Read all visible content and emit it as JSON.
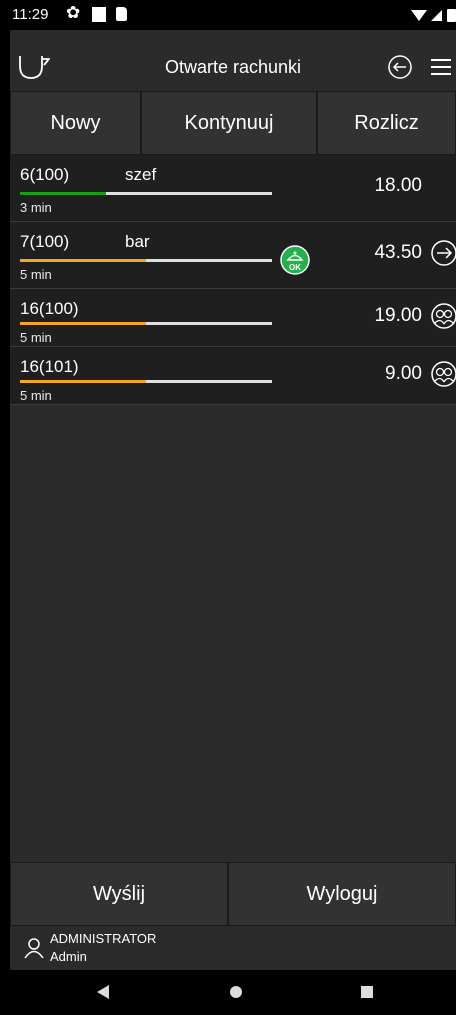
{
  "status_bar": {
    "time": "11:29"
  },
  "header": {
    "title": "Otwarte rachunki"
  },
  "actions": {
    "new": "Nowy",
    "continue": "Kontynuuj",
    "settle": "Rozlicz"
  },
  "orders": [
    {
      "number": "6(100)",
      "name": "szef",
      "time": "3 min",
      "amount": "18.00",
      "progress": 0.34,
      "progress_color": "#1a9f1a",
      "icon": ""
    },
    {
      "number": "7(100)",
      "name": "bar",
      "time": "5 min",
      "amount": "43.50",
      "progress": 0.5,
      "progress_color": "#f5a623",
      "icon": "arrow-right-icon",
      "ok_badge": "OK"
    },
    {
      "number": "16(100)",
      "name": "",
      "time": "5 min",
      "amount": "19.00",
      "progress": 0.5,
      "progress_color": "#f5a623",
      "icon": "guests-icon"
    },
    {
      "number": "16(101)",
      "name": "",
      "time": "5 min",
      "amount": "9.00",
      "progress": 0.5,
      "progress_color": "#f5a623",
      "icon": "guests-icon"
    }
  ],
  "footer": {
    "send": "Wyślij",
    "logout": "Wyloguj"
  },
  "user": {
    "name": "ADMINISTRATOR",
    "role": "Admin"
  }
}
